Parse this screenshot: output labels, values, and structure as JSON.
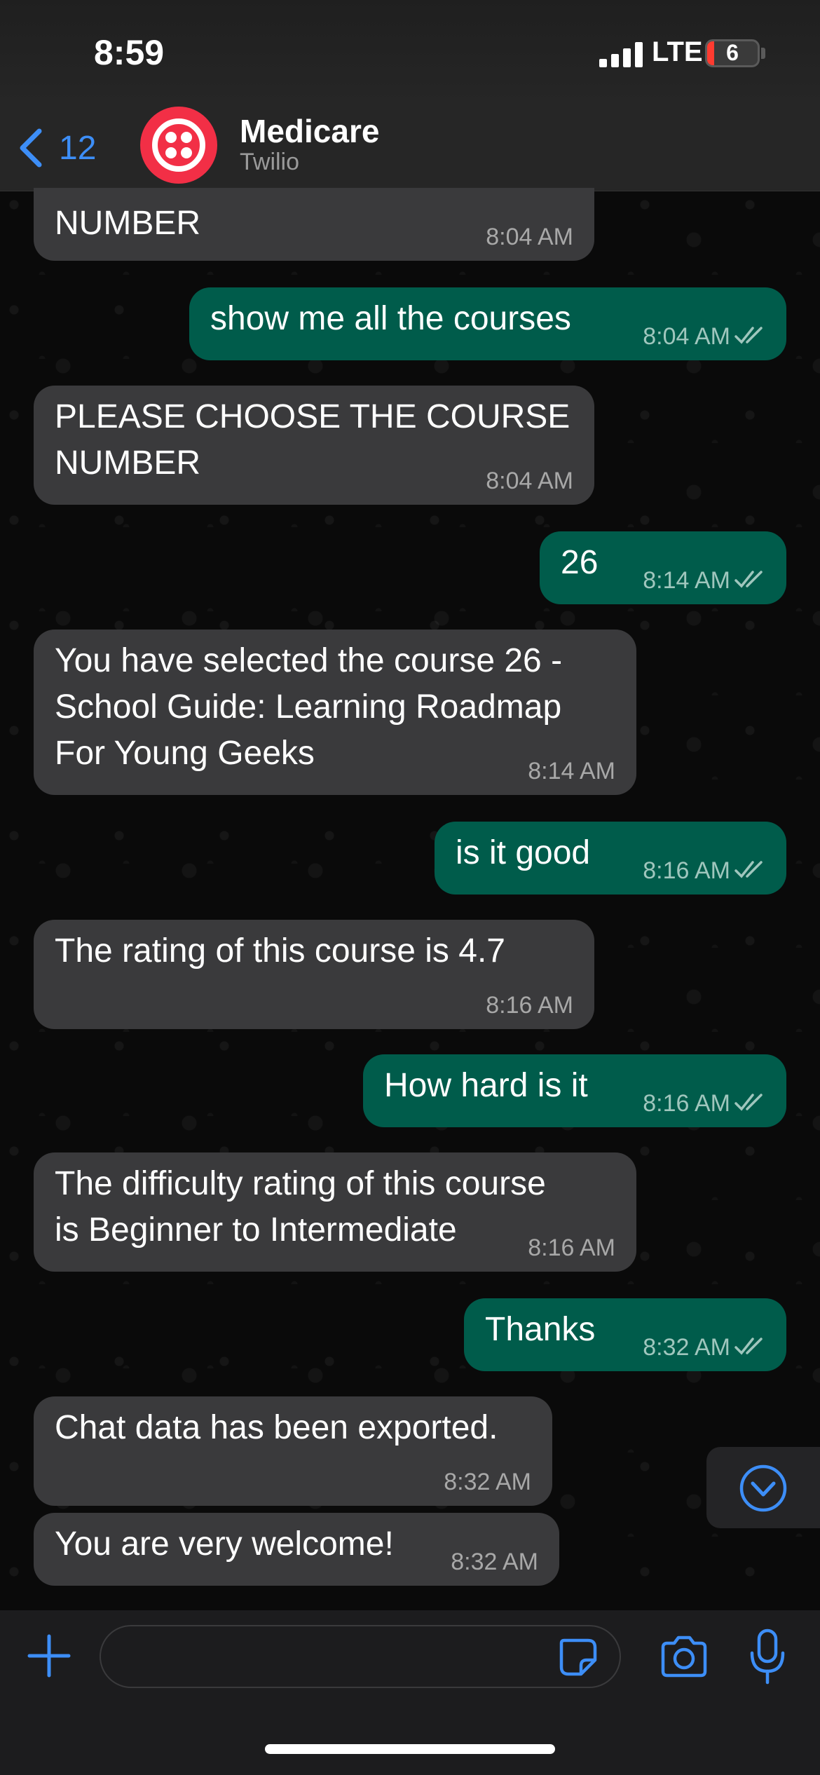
{
  "status_bar": {
    "time": "8:59",
    "network": "LTE",
    "battery": "6"
  },
  "header": {
    "back_count": "12",
    "contact_name": "Medicare",
    "contact_subtitle": "Twilio"
  },
  "messages": [
    {
      "dir": "in",
      "text": "NUMBER",
      "time": "8:04 AM"
    },
    {
      "dir": "out",
      "text": "show me all the courses",
      "time": "8:04 AM"
    },
    {
      "dir": "in",
      "text": "PLEASE CHOOSE THE COURSE\nNUMBER",
      "time": "8:04 AM"
    },
    {
      "dir": "out",
      "text": "26",
      "time": "8:14 AM"
    },
    {
      "dir": "in",
      "text": "You have selected the course 26 -\nSchool Guide: Learning Roadmap\nFor Young Geeks",
      "time": "8:14 AM"
    },
    {
      "dir": "out",
      "text": "is it good",
      "time": "8:16 AM"
    },
    {
      "dir": "in",
      "text": "The rating of this course is 4.7",
      "time": "8:16 AM"
    },
    {
      "dir": "out",
      "text": "How hard is it",
      "time": "8:16 AM"
    },
    {
      "dir": "in",
      "text": "The difficulty rating of this course\nis Beginner to Intermediate",
      "time": "8:16 AM"
    },
    {
      "dir": "out",
      "text": "Thanks",
      "time": "8:32 AM"
    },
    {
      "dir": "in",
      "text": "Chat data has been exported.",
      "time": "8:32 AM"
    },
    {
      "dir": "in",
      "text": "You are very welcome!",
      "time": "8:32 AM"
    }
  ],
  "composer": {
    "placeholder": ""
  },
  "icons": {
    "back": "chevron-left-icon",
    "attach": "plus-icon",
    "sticker": "sticker-icon",
    "camera": "camera-icon",
    "mic": "microphone-icon",
    "scroll": "chevron-down-circle-icon",
    "read": "double-check-icon"
  },
  "colors": {
    "incoming_bubble": "#3a3a3c",
    "outgoing_bubble": "#005c4b",
    "accent": "#3d8ef7",
    "avatar": "#f22f46"
  }
}
